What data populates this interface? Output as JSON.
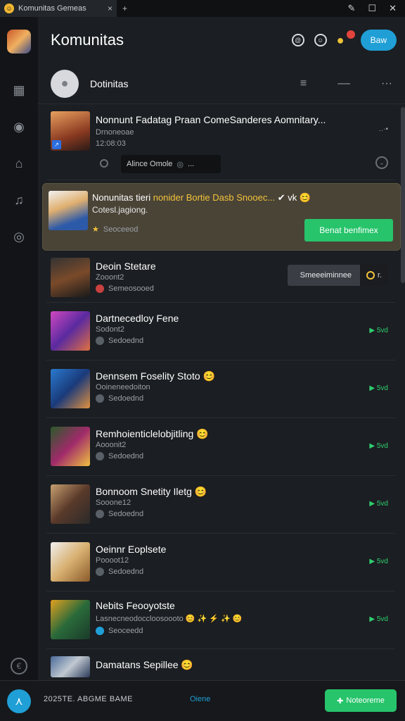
{
  "titlebar": {
    "tab_title": "Komunitas Gemeas",
    "tab_close": "×",
    "newtab": "+",
    "win_edit": "✎",
    "win_max": "☐",
    "win_close": "✕"
  },
  "header": {
    "title": "Komunitas",
    "new_button": "Baw"
  },
  "subheader": {
    "title": "Dotinitas"
  },
  "feed": {
    "first": {
      "title": "Nonnunt Fadatag Praan ComeSanderes Aomnitary...",
      "sub1": "Drnoneoae",
      "sub2": "12:08:03",
      "pill": "Alince Omole",
      "more": "..."
    },
    "highlight": {
      "title_a": "Nonunitas tieri ",
      "title_b": "nonider Bortie Dasb Snooec...",
      "title_c": "✔ vk 😊",
      "subtitle": "Cotesl.jagiong.",
      "meta": "Seoceeod",
      "button": "Benat benfimex"
    },
    "items": [
      {
        "title": "Deoin Stetare",
        "sub": "Zooont2",
        "meta": "Semeosooed",
        "button": "Smeeeiminnee",
        "ring_label": "r.",
        "type": "dark"
      },
      {
        "title": "Dartnecedloy Fene",
        "sub": "Sodont2",
        "meta": "Sedoednd",
        "act": "▶ 5vd"
      },
      {
        "title": "Dennsem Foselity Stoto 😊",
        "sub": "Ooineneedoiton",
        "meta": "Sedoednd",
        "act": "▶ 5vd"
      },
      {
        "title": "Remhoienticlelobjitling 😊",
        "sub": "Aooonit2",
        "meta": "Sedoednd",
        "act": "▶ 5vd"
      },
      {
        "title": "Bonnoom Snetity Iletg 😊",
        "sub": "Sooone12",
        "meta": "Sedoednd",
        "act": "▶ 5vd"
      },
      {
        "title": "Oeinnr Eoplsete",
        "sub": "Poooot12",
        "meta": "Sedoednd",
        "act": "▶ 5vd"
      },
      {
        "title": "Nebits Feooyotste",
        "sub": "Lasnecneodoccloosoooto",
        "emojis": "😊 ✨ ⚡ ✨ 😊",
        "meta": "Seoceedd",
        "act": "▶ 5vd"
      },
      {
        "title": "Damatans Sepillee 😊"
      }
    ]
  },
  "bottombar": {
    "text": "2025TE.  ABGME BAME",
    "link": "Oiene",
    "button": "Noteoreme",
    "button_icon": "✚"
  },
  "colors": {
    "accent": "#1f9fd6",
    "green": "#27c46b",
    "highlight_bg": "#4a4437"
  }
}
